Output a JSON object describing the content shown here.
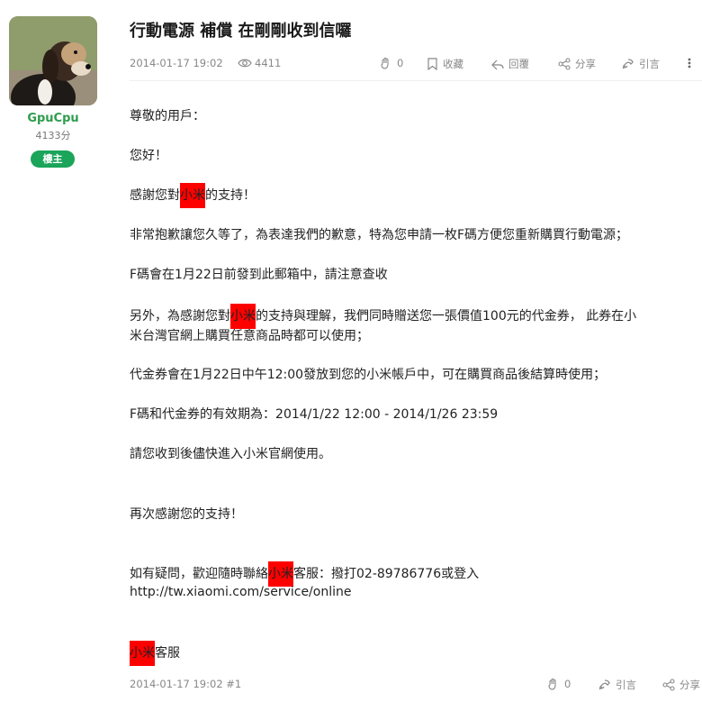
{
  "user": {
    "name": "GpuCpu",
    "points": "4133分",
    "badge": "樓主"
  },
  "post": {
    "title": "行動電源 補償 在剛剛收到信囉",
    "date": "2014-01-17 19:02",
    "views": "4411",
    "actions": {
      "likes": "0",
      "collect": "收藏",
      "reply": "回覆",
      "share": "分享",
      "quote": "引言"
    }
  },
  "body": {
    "l1": "尊敬的用戶：",
    "l2": "您好！",
    "l3a": "感謝您對",
    "l3b": "小米",
    "l3c": "的支持！",
    "l4": "非常抱歉讓您久等了，為表達我們的歉意，特為您申請一枚F碼方便您重新購買行動電源；",
    "l5": "F碼會在1月22日前發到此郵箱中，請注意查收",
    "l6a": "另外，為感謝您對",
    "l6b": "小米",
    "l6c": "的支持與理解，我們同時贈送您一張價值100元的代金券，  此券在小",
    "l7": "米台灣官網上購買任意商品時都可以使用；",
    "l8": "代金券會在1月22日中午12:00發放到您的小米帳戶中，可在購買商品後結算時使用；",
    "l9": "F碼和代金券的有效期為：2014/1/22 12:00  -  2014/1/26 23:59",
    "l10": "請您收到後儘快進入小米官網使用。",
    "l11": "再次感謝您的支持！",
    "l12a": "如有疑問，歡迎隨時聯絡",
    "l12b": "小米",
    "l12c": "客服：撥打02-89786776或登入",
    "l13": "http://tw.xiaomi.com/service/online",
    "l14a": "小米",
    "l14b": "客服"
  },
  "footer": {
    "date": "2014-01-17 19:02 #1",
    "likes": "0",
    "quote": "引言",
    "share": "分享"
  },
  "colors": {
    "accent": "#1aa55a",
    "highlight": "#ff0000"
  }
}
